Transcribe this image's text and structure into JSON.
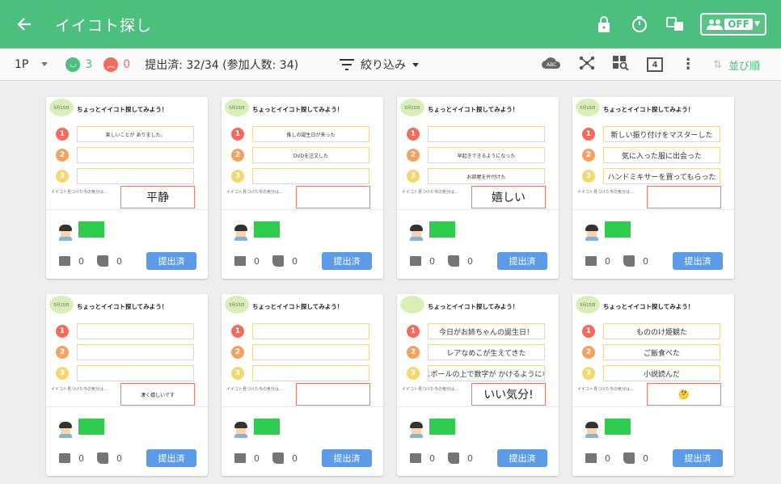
{
  "appbar": {
    "title": "イイコト探し",
    "off_label": "OFF"
  },
  "toolbar": {
    "page": "1P",
    "positive_count": "3",
    "negative_count": "0",
    "status": "提出済: 32/34 (参加人数: 34)",
    "filter_label": "絞り込み",
    "grid_count": "4",
    "sort_label": "並び順"
  },
  "card_common": {
    "heading": "ちょっとイイコト探してみよう！",
    "mood_label": "イイコト見つけた今の気分は…",
    "submit_label": "提出済",
    "comments": "0",
    "likes": "0"
  },
  "cards": [
    {
      "badge": "5月15日",
      "answers": [
        "楽しいことが\nありました。",
        "",
        ""
      ],
      "mood": "平静"
    },
    {
      "badge": "5月15日",
      "answers": [
        "推しの誕生日が来った",
        "DVDを注文した",
        ""
      ],
      "mood": ""
    },
    {
      "badge": "5月15日",
      "answers": [
        "",
        "早起きできるようになった",
        "お部屋を片付けた"
      ],
      "mood": "嬉しい"
    },
    {
      "badge": "5月15日",
      "answers": [
        "新しい振り付けをマスターした",
        "気に入った服に出会った",
        "ハンドミキサーを買ってもらった"
      ],
      "mood": ""
    },
    {
      "badge": "5月15日",
      "answers": [
        "",
        "",
        ""
      ],
      "mood": "凄く嬉しいです"
    },
    {
      "badge": "5月15日",
      "answers": [
        "",
        "",
        ""
      ],
      "mood": ""
    },
    {
      "badge": "",
      "answers": [
        "今日がお姉ちゃんの誕生日！",
        "レアなめこが生えてきた",
        "バランスボールの上で数字が\nかけるようになった！"
      ],
      "mood": "いい気分!"
    },
    {
      "badge": "5月15日",
      "answers": [
        "もののけ姫観た",
        "ご飯食べた",
        "小説読んだ"
      ],
      "mood": "🤔"
    }
  ]
}
